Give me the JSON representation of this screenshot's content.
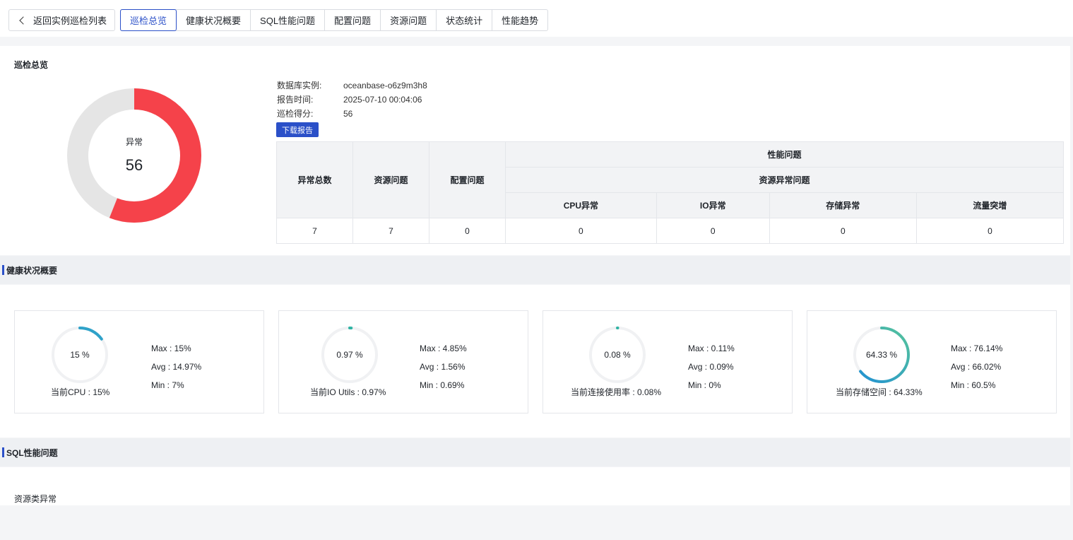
{
  "nav": {
    "back_label": "返回实例巡检列表",
    "tabs": [
      "巡检总览",
      "健康状况概要",
      "SQL性能问题",
      "配置问题",
      "资源问题",
      "状态统计",
      "性能趋势"
    ]
  },
  "overview": {
    "title": "巡检总览",
    "donut_label": "异常",
    "donut_value": "56",
    "score_fraction": 0.56,
    "colors": {
      "abnormal": "#f5424a",
      "normal": "#e5e5e5",
      "accent": "#2b50c8"
    },
    "info": [
      {
        "k": "数据库实例:",
        "v": "oceanbase-o6z9m3h8"
      },
      {
        "k": "报告时间:",
        "v": "2025-07-10 00:04:06"
      },
      {
        "k": "巡检得分:",
        "v": "56"
      }
    ],
    "download_label": "下载报告",
    "table": {
      "h_total": "异常总数",
      "h_resource": "资源问题",
      "h_config": "配置问题",
      "h_perf": "性能问题",
      "h_res_abn": "资源异常问题",
      "h_cpu": "CPU异常",
      "h_io": "IO异常",
      "h_storage": "存储异常",
      "h_traffic": "流量突增",
      "values": [
        "7",
        "7",
        "0",
        "0",
        "0",
        "0",
        "0"
      ]
    }
  },
  "health": {
    "title": "健康状况概要",
    "metrics": [
      {
        "pct": "15 %",
        "fraction": 0.15,
        "current": "当前CPU : 15%",
        "max": "Max :  15%",
        "avg": "Avg :  14.97%",
        "min": "Min :  7%"
      },
      {
        "pct": "0.97 %",
        "fraction": 0.0097,
        "current": "当前IO Utils : 0.97%",
        "max": "Max :  4.85%",
        "avg": "Avg :  1.56%",
        "min": "Min :  0.69%"
      },
      {
        "pct": "0.08 %",
        "fraction": 0.0008,
        "current": "当前连接使用率 : 0.08%",
        "max": "Max :  0.11%",
        "avg": "Avg :  0.09%",
        "min": "Min :  0%"
      },
      {
        "pct": "64.33 %",
        "fraction": 0.6433,
        "current": "当前存储空间 : 64.33%",
        "max": "Max :  76.14%",
        "avg": "Avg :  66.02%",
        "min": "Min :  60.5%"
      }
    ]
  },
  "sql": {
    "title": "SQL性能问题",
    "sub_title": "资源类异常"
  }
}
